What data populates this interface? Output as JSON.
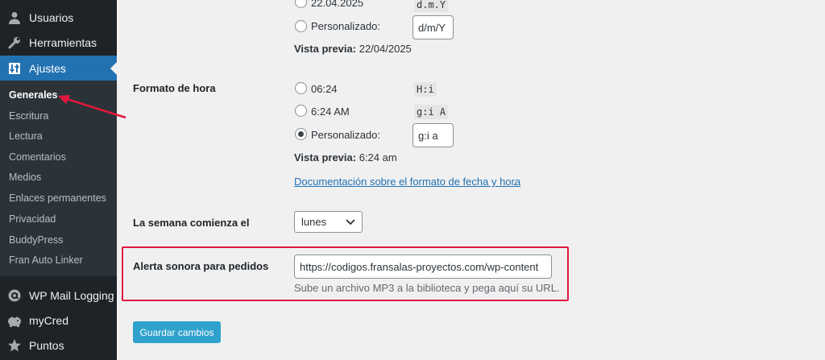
{
  "sidebar": {
    "top_items": [
      {
        "label": "Usuarios",
        "icon": "users-icon"
      },
      {
        "label": "Herramientas",
        "icon": "wrench-icon"
      },
      {
        "label": "Ajustes",
        "icon": "settings-icon"
      }
    ],
    "submenu": [
      "Generales",
      "Escritura",
      "Lectura",
      "Comentarios",
      "Medios",
      "Enlaces permanentes",
      "Privacidad",
      "BuddyPress",
      "Fran Auto Linker"
    ],
    "bottom_items": [
      {
        "label": "WP Mail Logging",
        "icon": "at-icon"
      },
      {
        "label": "myCred",
        "icon": "piggy-bank-icon"
      },
      {
        "label": "Puntos",
        "icon": "star-icon"
      }
    ]
  },
  "date_format": {
    "option_last_label": "22.04.2025",
    "option_last_code": "d.m.Y",
    "custom_label": "Personalizado:",
    "custom_value": "d/m/Y",
    "preview_label": "Vista previa:",
    "preview_value": "22/04/2025"
  },
  "time_format": {
    "title": "Formato de hora",
    "options": [
      {
        "label": "06:24",
        "code": "H:i"
      },
      {
        "label": "6:24 AM",
        "code": "g:i A"
      }
    ],
    "custom_label": "Personalizado:",
    "custom_value": "g:i a",
    "preview_label": "Vista previa:",
    "preview_value": "6:24 am",
    "doc_link": "Documentación sobre el formato de fecha y hora",
    "doc_link_suffix": "."
  },
  "week_start": {
    "title": "La semana comienza el",
    "selected": "lunes"
  },
  "sound_alert": {
    "title": "Alerta sonora para pedidos",
    "value": "https://codigos.fransalas-proyectos.com/wp-content",
    "description": "Sube un archivo MP3 a la biblioteca y pega aquí su URL."
  },
  "save_button": "Guardar cambios",
  "colors": {
    "accent": "#2271b1",
    "highlight": "#e3173e",
    "button": "#2ea2cc"
  }
}
